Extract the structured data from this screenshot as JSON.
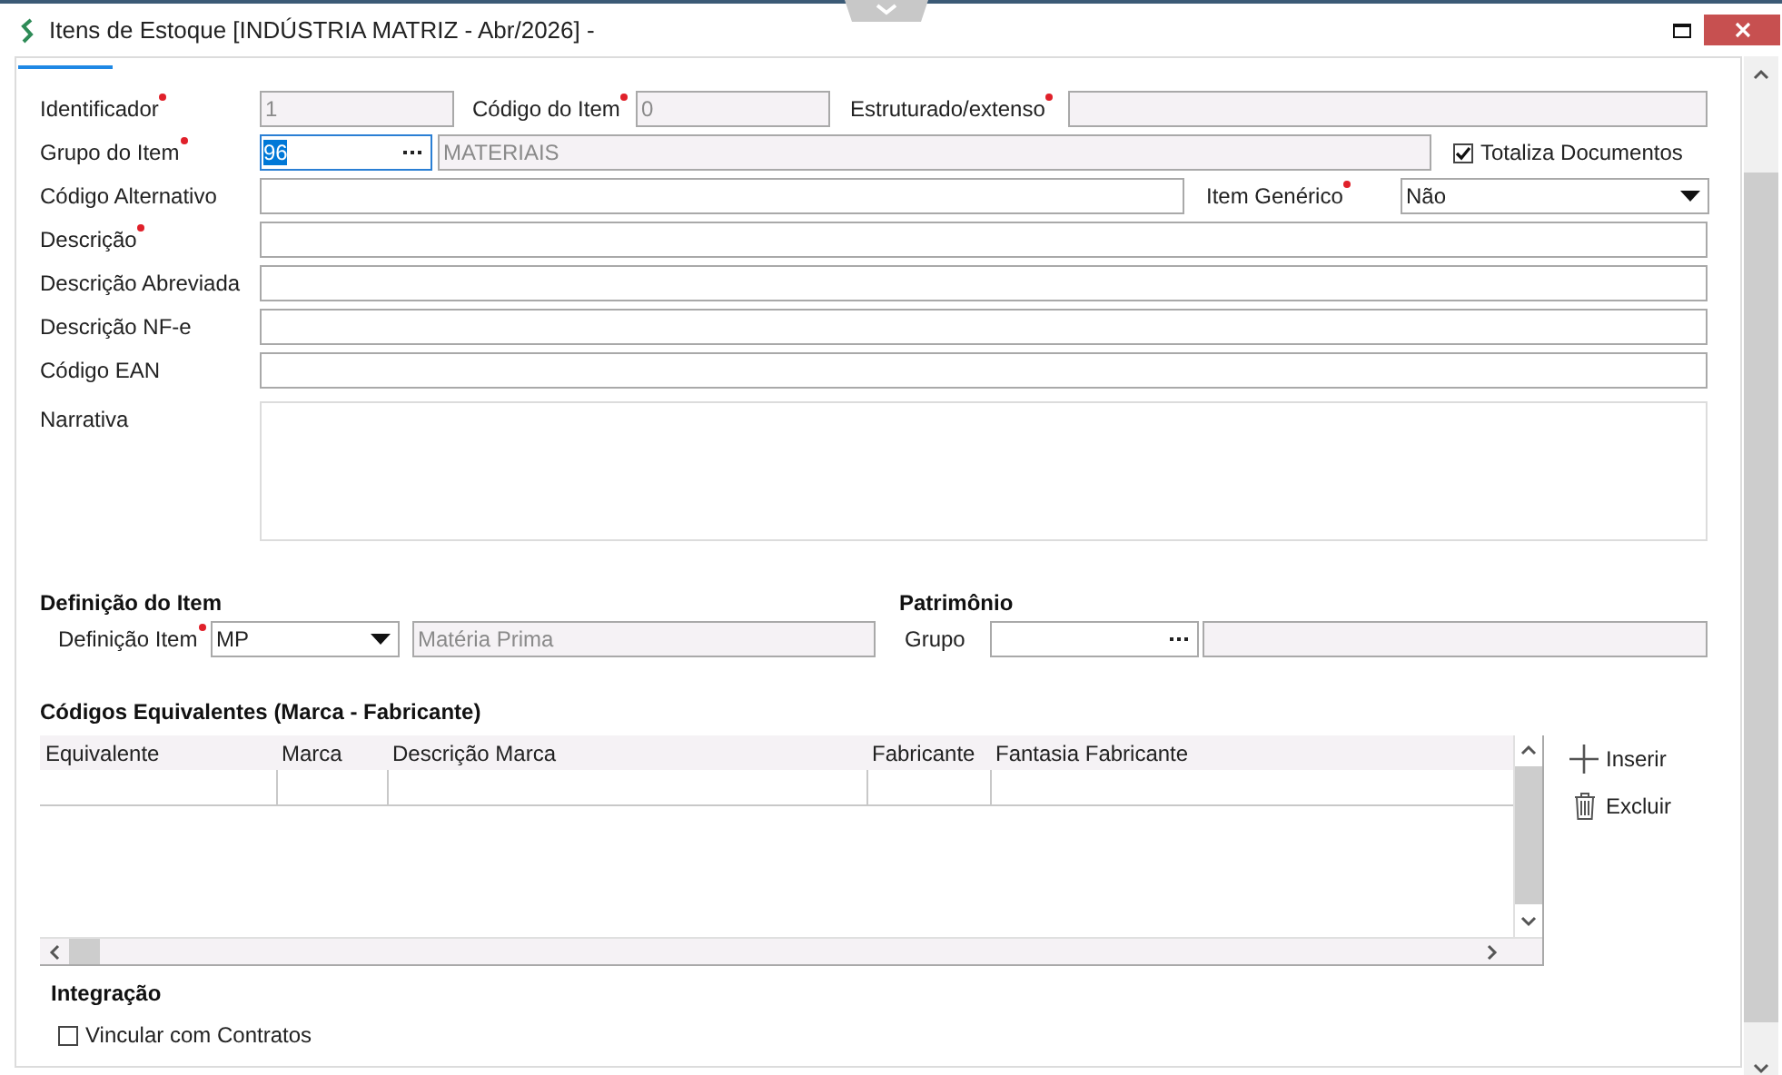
{
  "window": {
    "title": "Itens de Estoque [INDÚSTRIA MATRIZ - Abr/2026]  -"
  },
  "fields": {
    "identificador": {
      "label": "Identificador",
      "required": true,
      "value": "1",
      "disabled": true
    },
    "codigo_item": {
      "label": "Código do Item",
      "required": true,
      "value": "0",
      "disabled": true
    },
    "estruturado": {
      "label": "Estruturado/extenso",
      "required": true,
      "disabled": true
    },
    "grupo_item": {
      "label": "Grupo do Item",
      "required": true,
      "value": "96",
      "selected": true,
      "description": "MATERIAIS"
    },
    "totaliza": {
      "label": "Totaliza Documentos",
      "checked": true
    },
    "codigo_alternativo": {
      "label": "Código Alternativo",
      "required": false,
      "disabled": false
    },
    "item_generico": {
      "label": "Item Genérico",
      "required": true,
      "value": "Não"
    },
    "descricao": {
      "label": "Descrição",
      "required": true,
      "disabled": false
    },
    "descricao_abreviada": {
      "label": "Descrição Abreviada",
      "required": false,
      "disabled": false
    },
    "descricao_nfe": {
      "label": "Descrição NF-e",
      "required": false,
      "disabled": false
    },
    "codigo_ean": {
      "label": "Código EAN",
      "required": false,
      "disabled": false
    },
    "narrativa": {
      "label": "Narrativa",
      "required": false
    }
  },
  "definicao": {
    "heading": "Definição do Item",
    "label": "Definição Item",
    "required": true,
    "value": "MP",
    "description": "Matéria Prima"
  },
  "patrimonio": {
    "heading": "Patrimônio",
    "label": "Grupo",
    "required": false
  },
  "equivalentes": {
    "heading": "Códigos Equivalentes (Marca - Fabricante)",
    "columns": [
      "Equivalente",
      "Marca",
      "Descrição Marca",
      "Fabricante",
      "Fantasia Fabricante"
    ],
    "buttons": [
      {
        "label": "Inserir",
        "kind": "add"
      },
      {
        "label": "Excluir",
        "kind": "delete"
      }
    ]
  },
  "integracao": {
    "heading": "Integração",
    "checkbox": {
      "label": "Vincular com Contratos",
      "checked": false
    }
  }
}
